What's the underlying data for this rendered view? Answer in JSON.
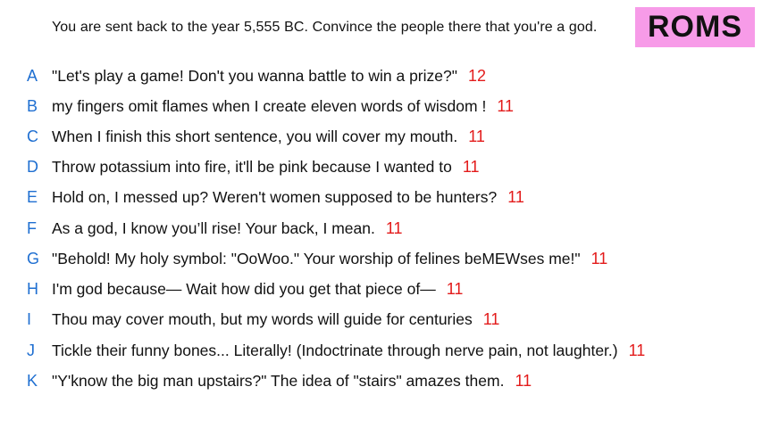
{
  "prompt": "You are sent back to the year 5,555 BC. Convince the people there that you're a god.",
  "badge": "ROMS",
  "colors": {
    "letter": "#1f6fd1",
    "score": "#e31b1b",
    "badge_bg": "#f79be8"
  },
  "answers": [
    {
      "letter": "A",
      "text": "\"Let's play a game! Don't you wanna battle to win a prize?\"",
      "score": "12"
    },
    {
      "letter": "B",
      "text": "my fingers omit flames when I create eleven words of wisdom !",
      "score": "11"
    },
    {
      "letter": "C",
      "text": "When I finish this short sentence, you will cover my mouth.",
      "score": "11"
    },
    {
      "letter": "D",
      "text": "Throw potassium into fire, it'll be pink because I wanted to",
      "score": "11"
    },
    {
      "letter": "E",
      "text": "Hold on, I messed up? Weren't women supposed to be hunters?",
      "score": "11"
    },
    {
      "letter": "F",
      "text": "As a god, I know you’ll rise! Your back, I mean.",
      "score": "11"
    },
    {
      "letter": "G",
      "text": "\"Behold! My holy symbol: \"OoWoo.\" Your worship of felines beMEWses me!\"",
      "score": "11"
    },
    {
      "letter": "H",
      "text": "I'm god because— Wait how did you get that piece of—",
      "score": "11"
    },
    {
      "letter": "I",
      "text": "Thou may cover mouth, but my words will guide for centuries",
      "score": "11"
    },
    {
      "letter": "J",
      "text": "Tickle their funny bones... Literally! (Indoctrinate through nerve pain, not laughter.)",
      "score": "11"
    },
    {
      "letter": "K",
      "text": "\"Y'know the big man upstairs?\" The idea of \"stairs\" amazes them.",
      "score": "11"
    }
  ]
}
